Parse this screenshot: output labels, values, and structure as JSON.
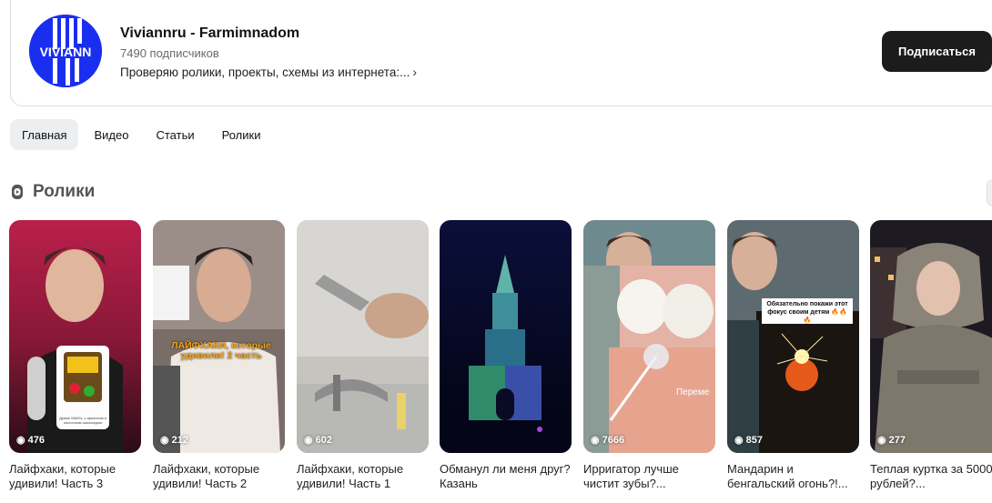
{
  "channel": {
    "name": "Viviannru - Farmimnadom",
    "subscribers": "7490 подписчиков",
    "description": "Проверяю ролики, проекты, схемы из интернета:...",
    "avatar_text": "VIVIANN",
    "subscribe_label": "Подписаться"
  },
  "tabs": [
    {
      "label": "Главная",
      "active": true
    },
    {
      "label": "Видео",
      "active": false
    },
    {
      "label": "Статьи",
      "active": false
    },
    {
      "label": "Ролики",
      "active": false
    }
  ],
  "section": {
    "title": "Ролики",
    "icon": "shorts-icon"
  },
  "shorts": [
    {
      "views": "476",
      "title": "Лайфхаки, которые удивили! Часть 3",
      "overlay": "Драже M&M's, с арахисом и молочным шоколадом"
    },
    {
      "views": "212",
      "title": "Лайфхаки, которые удивили! Часть 2",
      "overlay": "ЛАЙФХАКИ, которые удивили! 2 часть"
    },
    {
      "views": "602",
      "title": "Лайфхаки, которые удивили! Часть 1",
      "overlay": ""
    },
    {
      "views": "",
      "title": "Обманул ли меня друг? Казань",
      "overlay": ""
    },
    {
      "views": "7666",
      "title": "Ирригатор лучше чистит зубы?...",
      "overlay": "Переме"
    },
    {
      "views": "857",
      "title": "Мандарин и бенгальский огонь?!...",
      "overlay": "Обязательно покажи этот фокус своим детям 🔥🔥🔥"
    },
    {
      "views": "277",
      "title": "Теплая куртка за 5000 рублей?...",
      "overlay": ""
    }
  ],
  "colors": {
    "avatar_bg": "#1a2ef0",
    "button_bg": "#1c1c1c",
    "tab_active_bg": "#eceef0"
  }
}
